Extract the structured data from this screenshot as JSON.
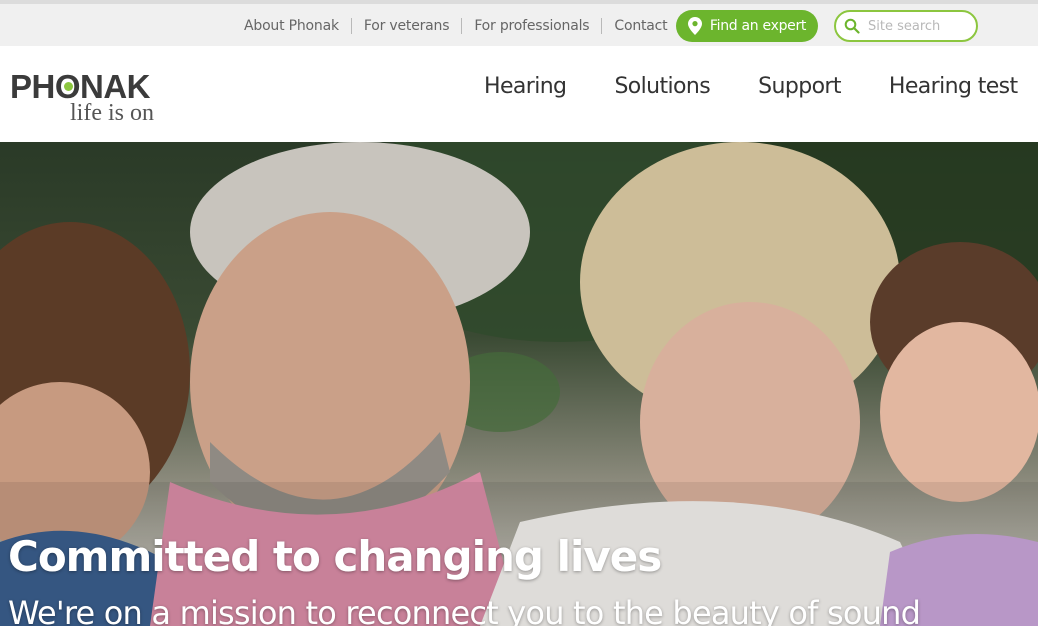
{
  "utility_nav": {
    "links": [
      "About Phonak",
      "For veterans",
      "For professionals",
      "Contact"
    ],
    "expert_button": "Find an expert",
    "search_placeholder": "Site search"
  },
  "brand": {
    "name": "PHONAK",
    "tagline": "life is on",
    "accent_color": "#8cc63f",
    "button_color": "#6cb52d"
  },
  "main_nav": [
    "Hearing",
    "Solutions",
    "Support",
    "Hearing test"
  ],
  "hero": {
    "title": "Committed to changing lives",
    "subtitle": "We're on a mission to reconnect you to the beauty of sound"
  },
  "icons": {
    "expert": "map-pin-icon",
    "search": "search-icon"
  }
}
